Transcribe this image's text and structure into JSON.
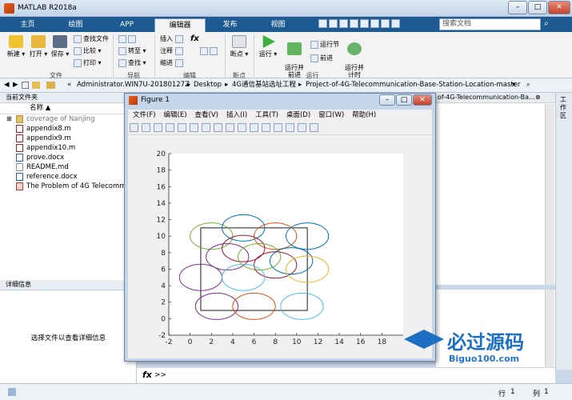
{
  "window": {
    "title": "MATLAB R2018a",
    "minimize": "–",
    "maximize": "□",
    "close": "✕"
  },
  "tabs": [
    {
      "label": "主页"
    },
    {
      "label": "绘图"
    },
    {
      "label": "APP"
    },
    {
      "label": "编辑器",
      "active": true
    },
    {
      "label": "发布"
    },
    {
      "label": "视图"
    }
  ],
  "search": {
    "placeholder": "搜索文档"
  },
  "ribbon": {
    "file_group": {
      "label": "文件",
      "new": "新建",
      "open": "打开",
      "save": "保存",
      "find_files": "查找文件",
      "compare": "比较",
      "print": "打印"
    },
    "nav_group": {
      "label": "导航",
      "goto": "转至",
      "find": "查找"
    },
    "edit_group": {
      "label": "编辑",
      "insert": "插入",
      "comment": "注释",
      "indent": "缩进"
    },
    "breakpoint_group": {
      "label": "断点",
      "breakpoints": "断点"
    },
    "run_group": {
      "label": "运行",
      "run": "运行",
      "run_advance": "运行并\n前进",
      "run_section": "运行节",
      "advance": "前进",
      "run_time": "运行并\n计时"
    }
  },
  "path": {
    "prefix": "«",
    "segments": [
      "Administrator.WIN7U-20180127Z",
      "Desktop",
      "4G通信基站选址工程",
      "Project-of-4G-Telecommunication-Base-Station-Location-master"
    ]
  },
  "current_folder": {
    "title": "当前文件夹",
    "column_name": "名称 ▲",
    "files": [
      {
        "name": "coverage of Nanjing",
        "type": "folder"
      },
      {
        "name": "appendix8.m",
        "type": "m"
      },
      {
        "name": "appendix9.m",
        "type": "m"
      },
      {
        "name": "appendix10.m",
        "type": "m"
      },
      {
        "name": "prove.docx",
        "type": "docx"
      },
      {
        "name": "README.md",
        "type": "md"
      },
      {
        "name": "reference.docx",
        "type": "docx"
      },
      {
        "name": "The Problem of 4G Telecommu",
        "type": "pdf"
      }
    ]
  },
  "details": {
    "title": "详细信息",
    "message": "选择文件以查看详细信息"
  },
  "editor_tab": {
    "label": "of-4G-Telecommunication-Ba..."
  },
  "right_strip": {
    "label": "工作区"
  },
  "command": {
    "fx": "fx",
    "prompt": ">>"
  },
  "status": {
    "row_label": "行",
    "row": "1",
    "col_label": "列",
    "col": "1"
  },
  "figure": {
    "title": "Figure 1",
    "menu": [
      "文件(F)",
      "编辑(E)",
      "查看(V)",
      "插入(I)",
      "工具(T)",
      "桌面(D)",
      "窗口(W)",
      "帮助(H)"
    ]
  },
  "chart_data": {
    "type": "scatter",
    "title": "",
    "xlabel": "",
    "ylabel": "",
    "xlim": [
      -2,
      20
    ],
    "ylim": [
      -2,
      20
    ],
    "xticks": [
      -2,
      0,
      2,
      4,
      6,
      8,
      10,
      12,
      14,
      16,
      18
    ],
    "yticks": [
      -2,
      0,
      2,
      4,
      6,
      8,
      10,
      12,
      14,
      16,
      18,
      20
    ],
    "grid": false,
    "rectangle": {
      "x": [
        1,
        11
      ],
      "y": [
        1,
        11
      ]
    },
    "circle_radius_x": 2.0,
    "circle_radius_y": 1.6,
    "circles": [
      {
        "cx": 2.0,
        "cy": 10.0,
        "color": "#77ac30"
      },
      {
        "cx": 5.0,
        "cy": 11.0,
        "color": "#0072bd"
      },
      {
        "cx": 8.0,
        "cy": 10.0,
        "color": "#d95319"
      },
      {
        "cx": 11.0,
        "cy": 10.0,
        "color": "#0072bd"
      },
      {
        "cx": 3.5,
        "cy": 7.5,
        "color": "#7e2f8e"
      },
      {
        "cx": 5.0,
        "cy": 8.5,
        "color": "#a2142f"
      },
      {
        "cx": 6.5,
        "cy": 7.5,
        "color": "#77ac30"
      },
      {
        "cx": 8.0,
        "cy": 6.5,
        "color": "#a2142f"
      },
      {
        "cx": 9.5,
        "cy": 7.0,
        "color": "#0072bd"
      },
      {
        "cx": 11.0,
        "cy": 6.0,
        "color": "#edb120"
      },
      {
        "cx": 1.0,
        "cy": 5.0,
        "color": "#7e2f8e"
      },
      {
        "cx": 5.0,
        "cy": 5.0,
        "color": "#4dbeee"
      },
      {
        "cx": 2.5,
        "cy": 1.5,
        "color": "#7e2f8e"
      },
      {
        "cx": 6.0,
        "cy": 1.5,
        "color": "#d95319"
      },
      {
        "cx": 10.5,
        "cy": 1.5,
        "color": "#4dbeee"
      }
    ]
  },
  "watermark": {
    "text": "必过源码",
    "url": "Biguo100.com"
  }
}
